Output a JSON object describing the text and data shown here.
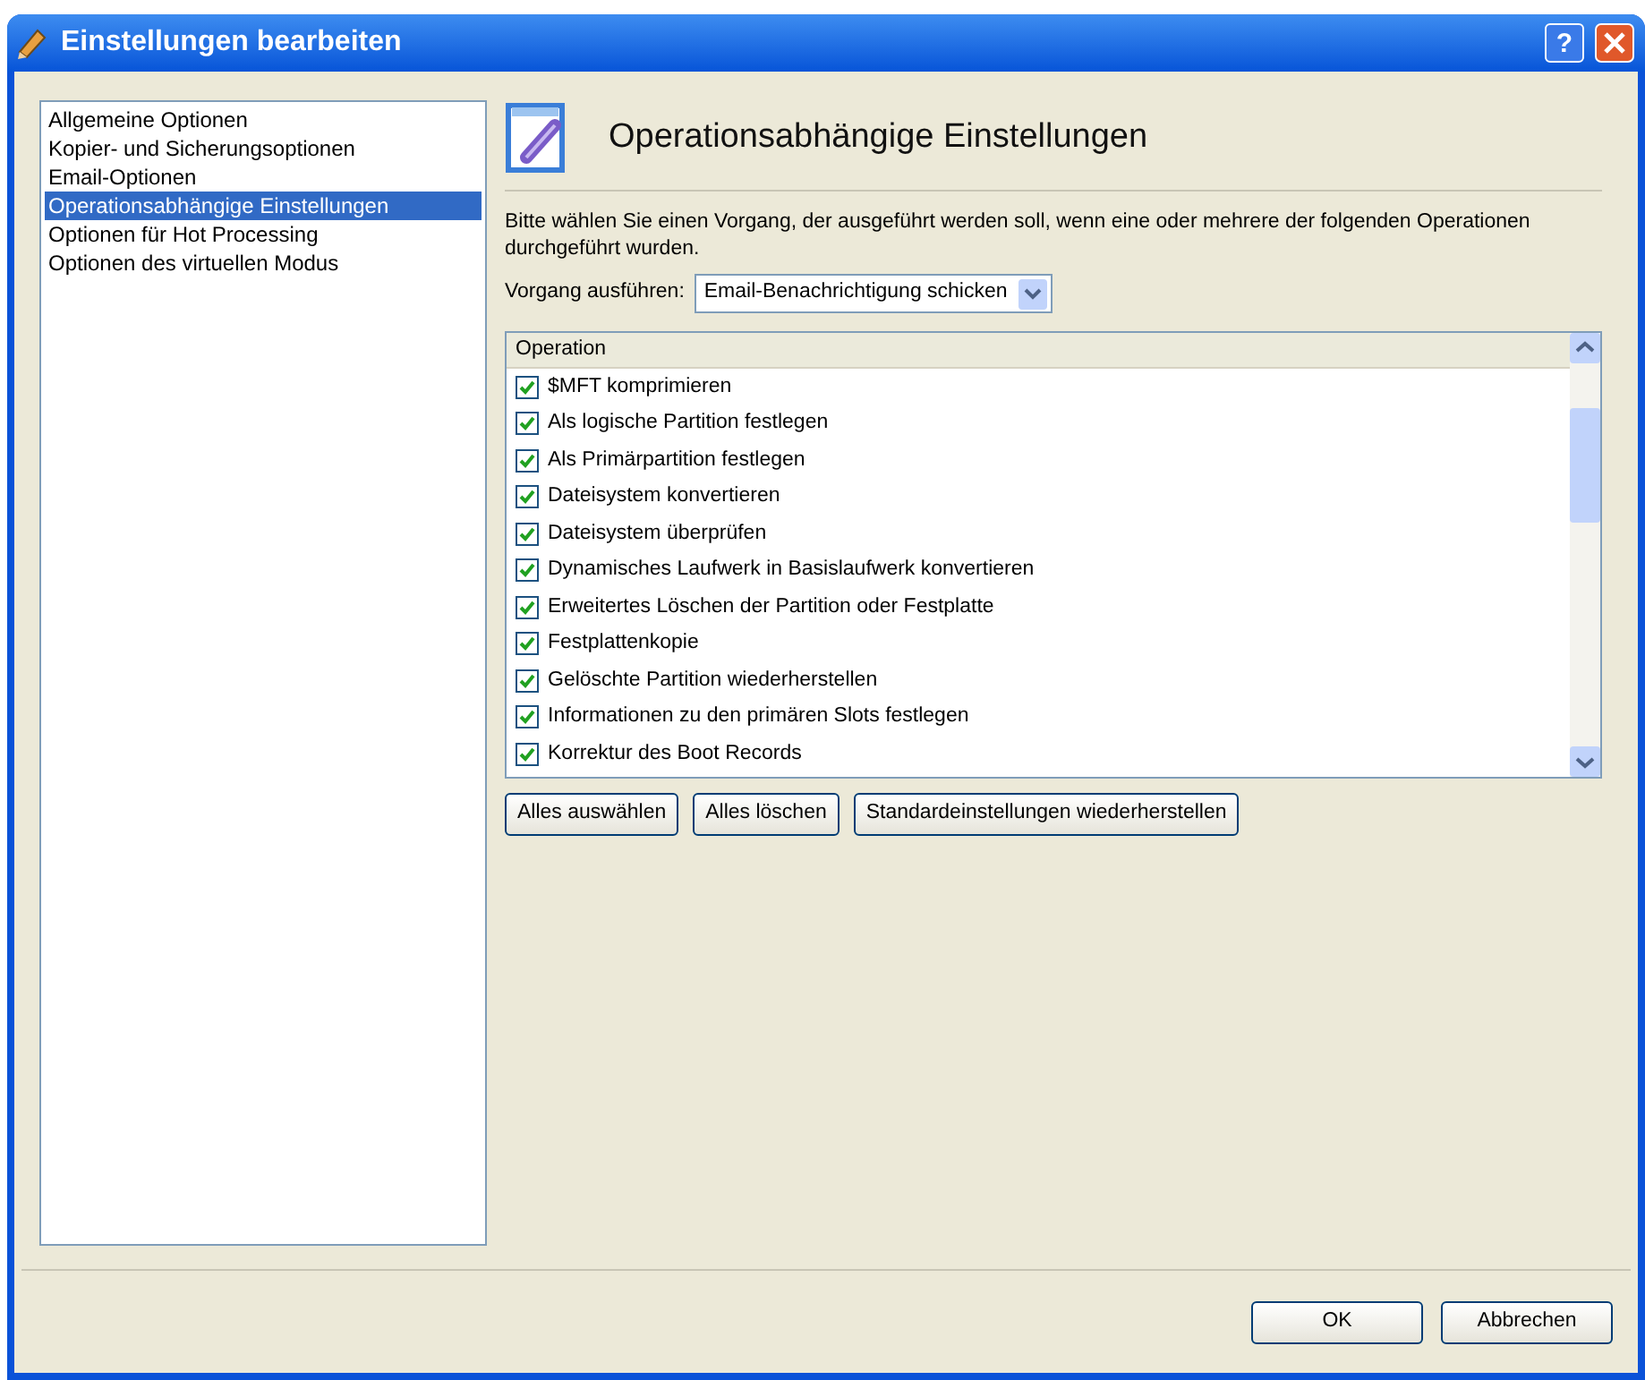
{
  "window": {
    "title": "Einstellungen bearbeiten"
  },
  "sidebar": {
    "items": [
      {
        "label": "Allgemeine Optionen",
        "selected": false
      },
      {
        "label": "Kopier- und Sicherungsoptionen",
        "selected": false
      },
      {
        "label": "Email-Optionen",
        "selected": false
      },
      {
        "label": "Operationsabhängige Einstellungen",
        "selected": true
      },
      {
        "label": "Optionen für Hot Processing",
        "selected": false
      },
      {
        "label": "Optionen des virtuellen Modus",
        "selected": false
      }
    ]
  },
  "panel": {
    "heading": "Operationsabhängige Einstellungen",
    "description": "Bitte wählen Sie einen Vorgang, der ausgeführt werden soll, wenn eine oder mehrere der folgenden Operationen durchgeführt wurden.",
    "action_label": "Vorgang ausführen:",
    "action_value": "Email-Benachrichtigung schicken",
    "list_header": "Operation",
    "operations": [
      {
        "label": "$MFT komprimieren",
        "checked": true
      },
      {
        "label": "Als logische Partition festlegen",
        "checked": true
      },
      {
        "label": "Als Primärpartition festlegen",
        "checked": true
      },
      {
        "label": "Dateisystem konvertieren",
        "checked": true
      },
      {
        "label": "Dateisystem überprüfen",
        "checked": true
      },
      {
        "label": "Dynamisches Laufwerk in Basislaufwerk konvertieren",
        "checked": true
      },
      {
        "label": "Erweitertes Löschen der Partition oder Festplatte",
        "checked": true
      },
      {
        "label": "Festplattenkopie",
        "checked": true
      },
      {
        "label": "Gelöschte Partition wiederherstellen",
        "checked": true
      },
      {
        "label": "Informationen zu den primären Slots festlegen",
        "checked": true
      },
      {
        "label": "Korrektur des Boot Records",
        "checked": true
      }
    ],
    "list_buttons": [
      "Alles auswählen",
      "Alles löschen",
      "Standardeinstellungen wiederherstellen"
    ]
  },
  "footer_buttons": [
    "OK",
    "Abbrechen"
  ],
  "title_buttons": [
    "?"
  ]
}
